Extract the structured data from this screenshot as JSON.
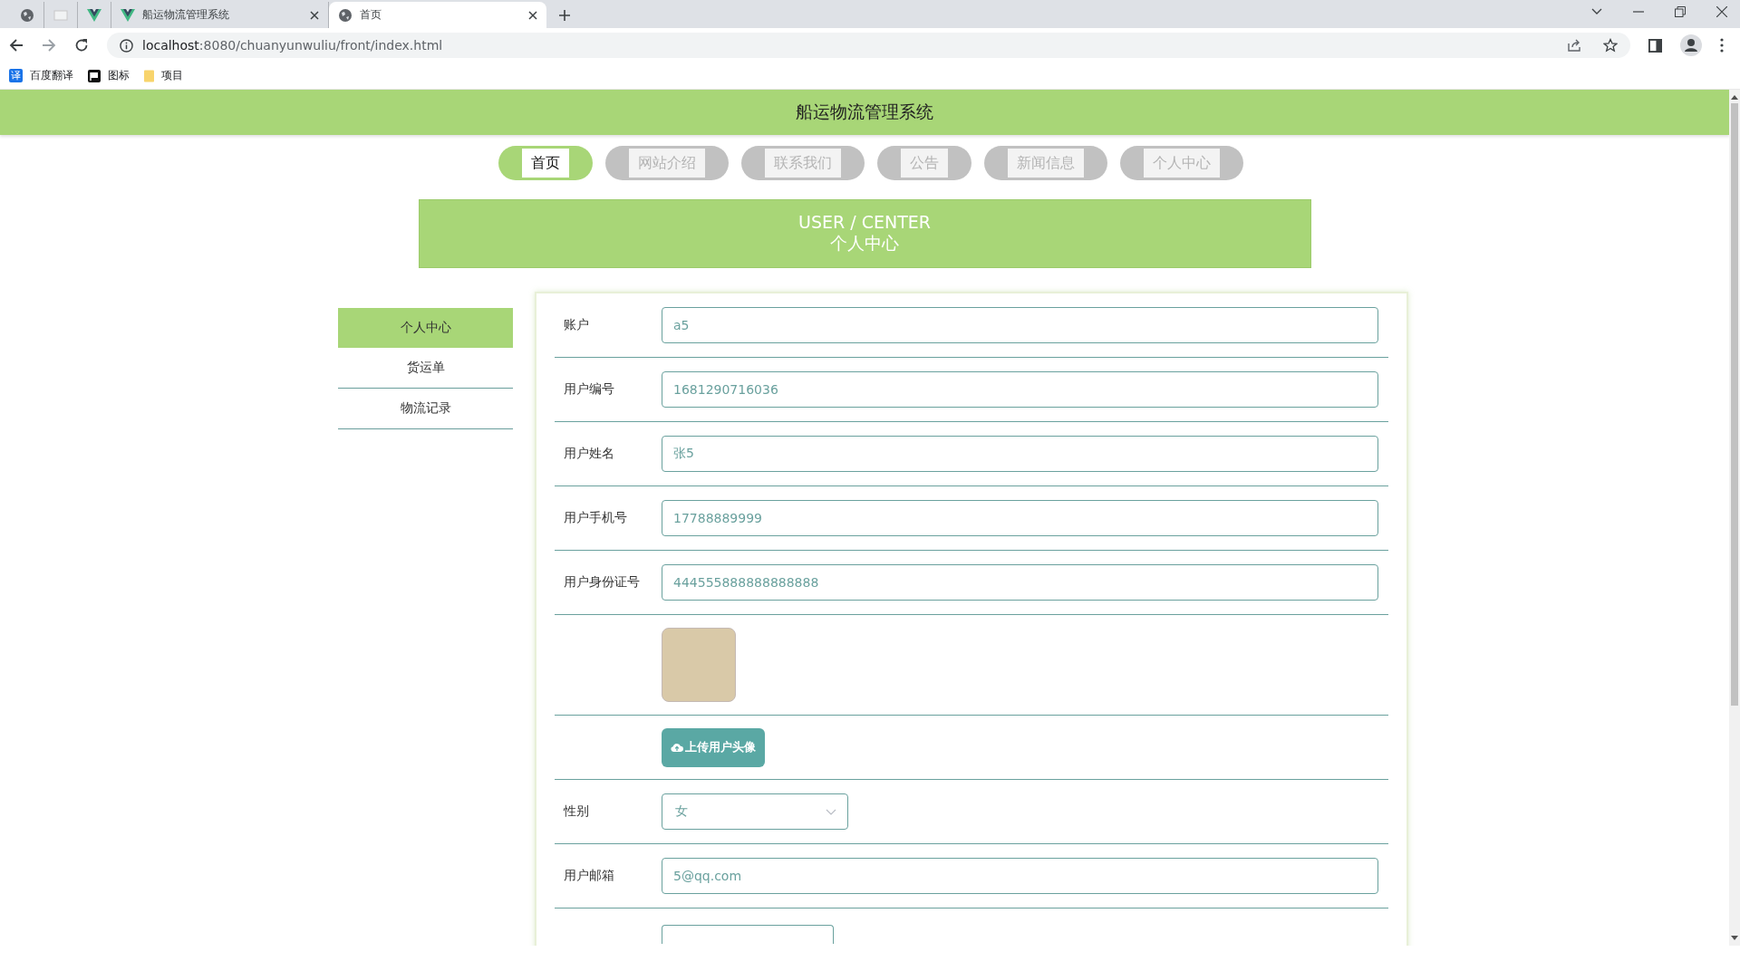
{
  "browser": {
    "tabs": [
      {
        "kind": "globe",
        "selected": false
      },
      {
        "kind": "blank",
        "selected": false
      },
      {
        "kind": "vue",
        "selected": false
      },
      {
        "kind": "vue",
        "title": "船运物流管理系统",
        "selected": false
      },
      {
        "kind": "globe",
        "title": "首页",
        "selected": true
      }
    ],
    "url_host": "localhost",
    "url_rest": ":8080/chuanyunwuliu/front/index.html",
    "bookmarks": [
      {
        "kind": "translate",
        "label": "百度翻译",
        "icon_text": "译"
      },
      {
        "kind": "flag",
        "label": "图标"
      },
      {
        "kind": "folder",
        "label": "项目"
      }
    ]
  },
  "header": {
    "title": "船运物流管理系统"
  },
  "nav": [
    {
      "label": "首页",
      "selected": true
    },
    {
      "label": "网站介绍",
      "selected": false
    },
    {
      "label": "联系我们",
      "selected": false
    },
    {
      "label": "公告",
      "selected": false
    },
    {
      "label": "新闻信息",
      "selected": false
    },
    {
      "label": "个人中心",
      "selected": false
    }
  ],
  "banner": {
    "title_en": "USER / CENTER",
    "title_zh": "个人中心"
  },
  "sidebar": {
    "items": [
      {
        "label": "个人中心",
        "selected": true
      },
      {
        "label": "货运单",
        "selected": false
      },
      {
        "label": "物流记录",
        "selected": false
      }
    ]
  },
  "form": {
    "rows": [
      {
        "kind": "text",
        "label": "账户",
        "value": "a5"
      },
      {
        "kind": "text",
        "label": "用户编号",
        "value": "1681290716036"
      },
      {
        "kind": "text",
        "label": "用户姓名",
        "value": "张5"
      },
      {
        "kind": "text",
        "label": "用户手机号",
        "value": "17788889999"
      },
      {
        "kind": "text",
        "label": "用户身份证号",
        "value": "444555888888888888"
      },
      {
        "kind": "avatar"
      },
      {
        "kind": "upload",
        "button": "上传用户头像"
      },
      {
        "kind": "select",
        "label": "性别",
        "value": "女"
      },
      {
        "kind": "text",
        "label": "用户邮箱",
        "value": "5@qq.com"
      },
      {
        "kind": "partial"
      }
    ]
  }
}
